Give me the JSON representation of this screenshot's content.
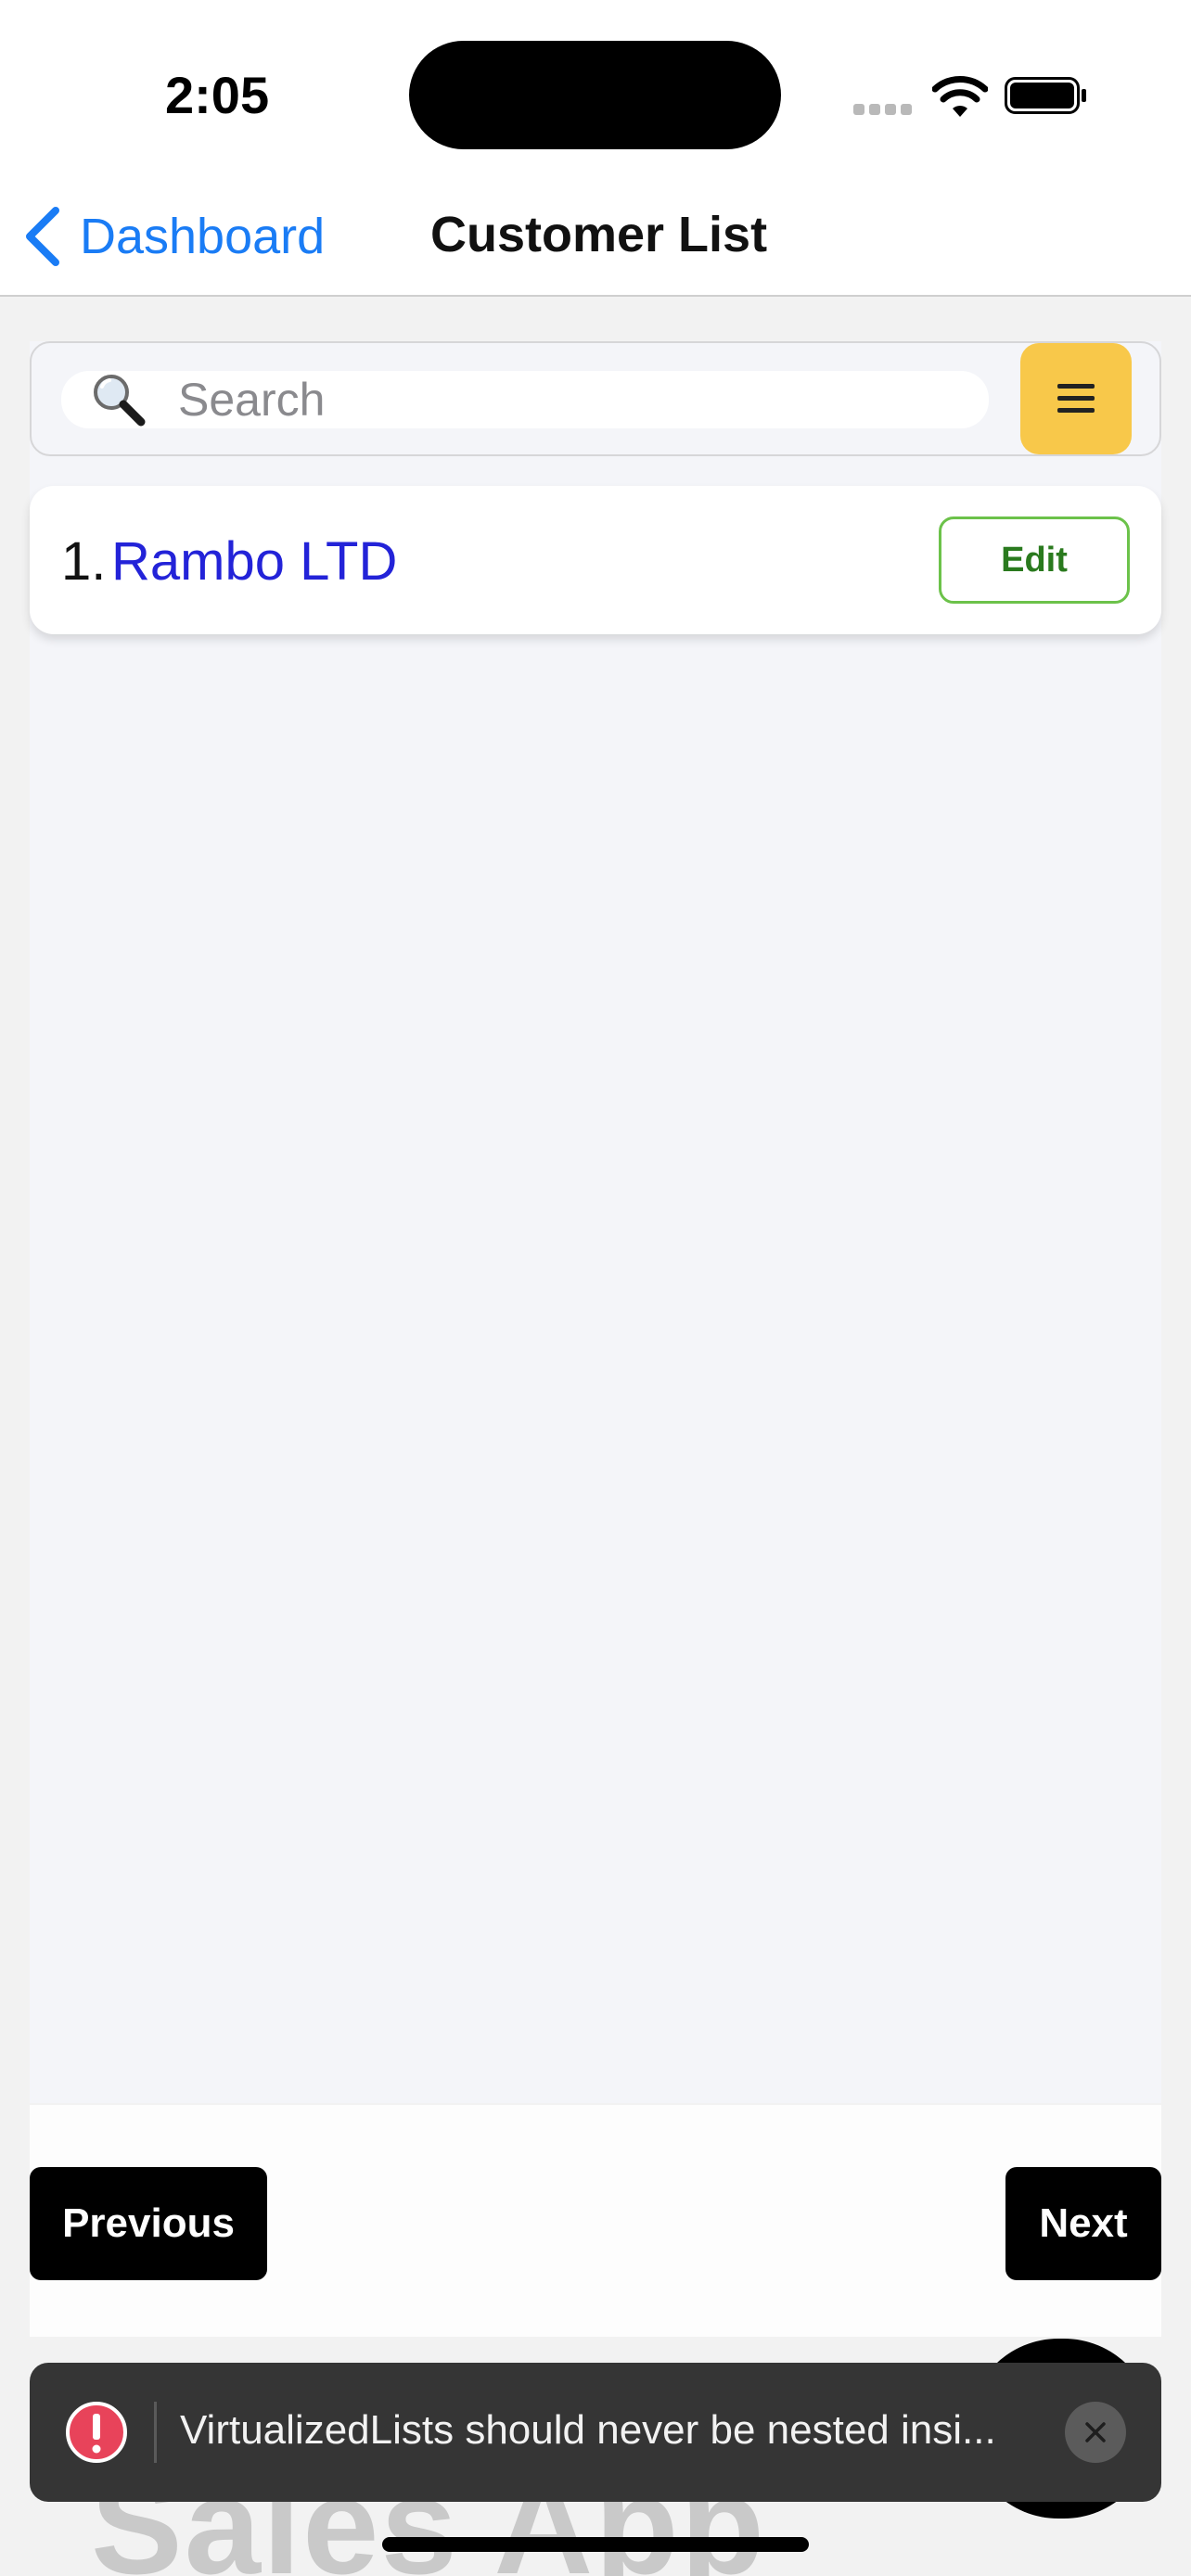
{
  "status_bar": {
    "time": "2:05"
  },
  "nav": {
    "back_label": "Dashboard",
    "title": "Customer List"
  },
  "search": {
    "placeholder": "Search",
    "value": ""
  },
  "customers": [
    {
      "index": "1.",
      "name": "Rambo LTD",
      "edit_label": "Edit"
    }
  ],
  "pagination": {
    "previous_label": "Previous",
    "next_label": "Next"
  },
  "background_text": "Sales App",
  "toast": {
    "message": "VirtualizedLists should never be nested insi..."
  },
  "icons": {
    "back": "chevron-left-icon",
    "search": "magnifying-glass-icon",
    "menu": "hamburger-icon",
    "error": "error-icon",
    "close": "close-icon"
  },
  "colors": {
    "link_blue": "#1a7cf5",
    "customer_name": "#2323d8",
    "menu_button": "#f8c84a",
    "edit_border": "#6cc24a",
    "edit_text": "#2a7a1e",
    "toast_bg": "#353535",
    "error_red": "#e8435a"
  }
}
